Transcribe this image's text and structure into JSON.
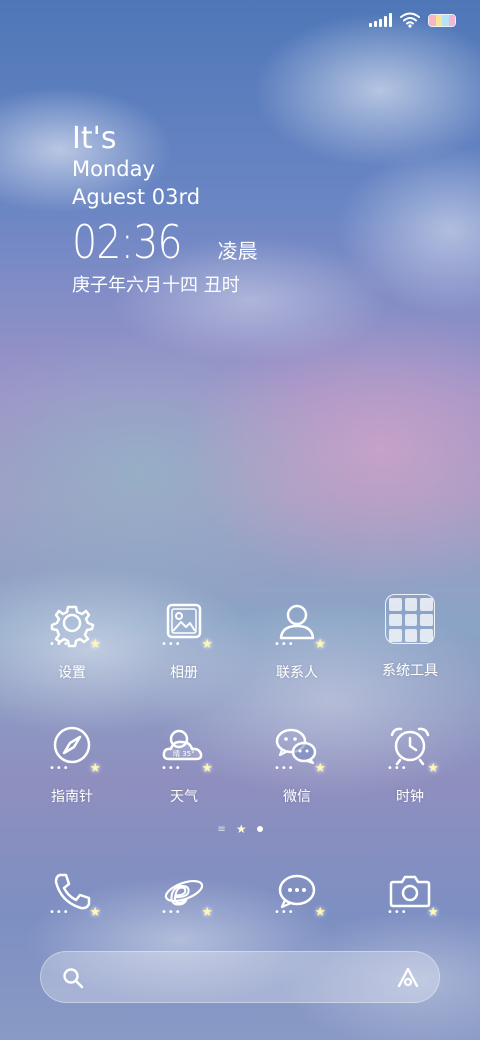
{
  "status_bar": {
    "icons": [
      "signal-icon",
      "wifi-icon",
      "battery-icon"
    ],
    "battery_colors": [
      "#f7b6c6",
      "#f9e29a",
      "#b6e2f5",
      "#f4b6d4"
    ]
  },
  "widget": {
    "line1": "It's",
    "line2": "Monday",
    "line3": "Aguest 03rd",
    "time": "02:36",
    "period": "凌晨",
    "lunar_date": "庚子年六月十四 丑时"
  },
  "apps": [
    {
      "label": "设置",
      "icon": "gear-icon"
    },
    {
      "label": "相册",
      "icon": "gallery-icon"
    },
    {
      "label": "联系人",
      "icon": "contact-icon"
    },
    {
      "label": "系统工具",
      "icon": "folder-icon"
    },
    {
      "label": "指南针",
      "icon": "compass-icon"
    },
    {
      "label": "天气",
      "icon": "weather-icon",
      "badge": "晴 35°"
    },
    {
      "label": "微信",
      "icon": "wechat-icon"
    },
    {
      "label": "时钟",
      "icon": "alarm-clock-icon"
    }
  ],
  "dock": [
    {
      "icon": "phone-icon"
    },
    {
      "icon": "browser-icon"
    },
    {
      "icon": "message-icon"
    },
    {
      "icon": "camera-icon"
    }
  ],
  "pager": {
    "pages": 3,
    "current": 2
  },
  "search_bar": {
    "icons": [
      "search-icon",
      "assistant-icon"
    ]
  }
}
